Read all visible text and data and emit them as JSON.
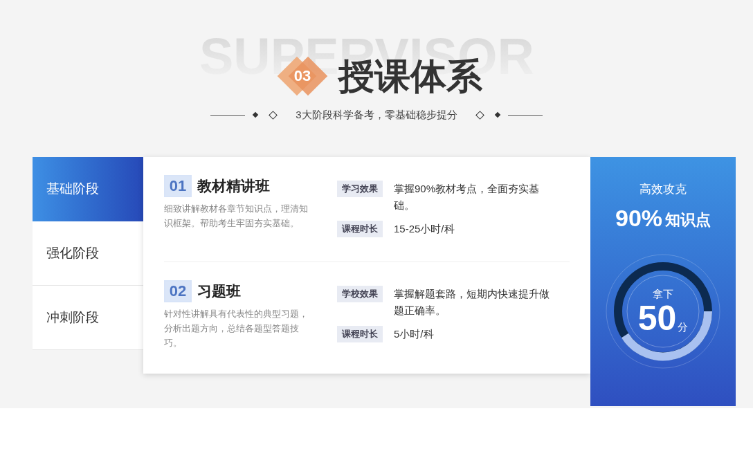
{
  "header": {
    "background_word": "SUPERVISOR",
    "badge": "03",
    "title": "授课体系",
    "subtitle": "3大阶段科学备考，零基础稳步提分"
  },
  "stages": [
    {
      "label": "基础阶段",
      "selected": true
    },
    {
      "label": "强化阶段",
      "selected": false
    },
    {
      "label": "冲刺阶段",
      "selected": false
    }
  ],
  "courses": [
    {
      "number": "01",
      "name": "教材精讲班",
      "description": "细致讲解教材各章节知识点，理清知识框架。帮助考生牢固夯实基础。",
      "details": [
        {
          "tag": "学习效果",
          "text": "掌握90%教材考点，全面夯实基础。"
        },
        {
          "tag": "课程时长",
          "text": "15-25小时/科"
        }
      ]
    },
    {
      "number": "02",
      "name": "习题班",
      "description": "针对性讲解具有代表性的典型习题，分析出题方向，总结各题型答题技巧。",
      "details": [
        {
          "tag": "学校效果",
          "text": "掌握解题套路，短期内快速提升做题正确率。"
        },
        {
          "tag": "课程时长",
          "text": "5小时/科"
        }
      ]
    }
  ],
  "promo": {
    "caption": "高效攻克",
    "percent": "90%",
    "percent_label": "知识点",
    "ring_label": "拿下",
    "score": "50",
    "unit": "分"
  }
}
